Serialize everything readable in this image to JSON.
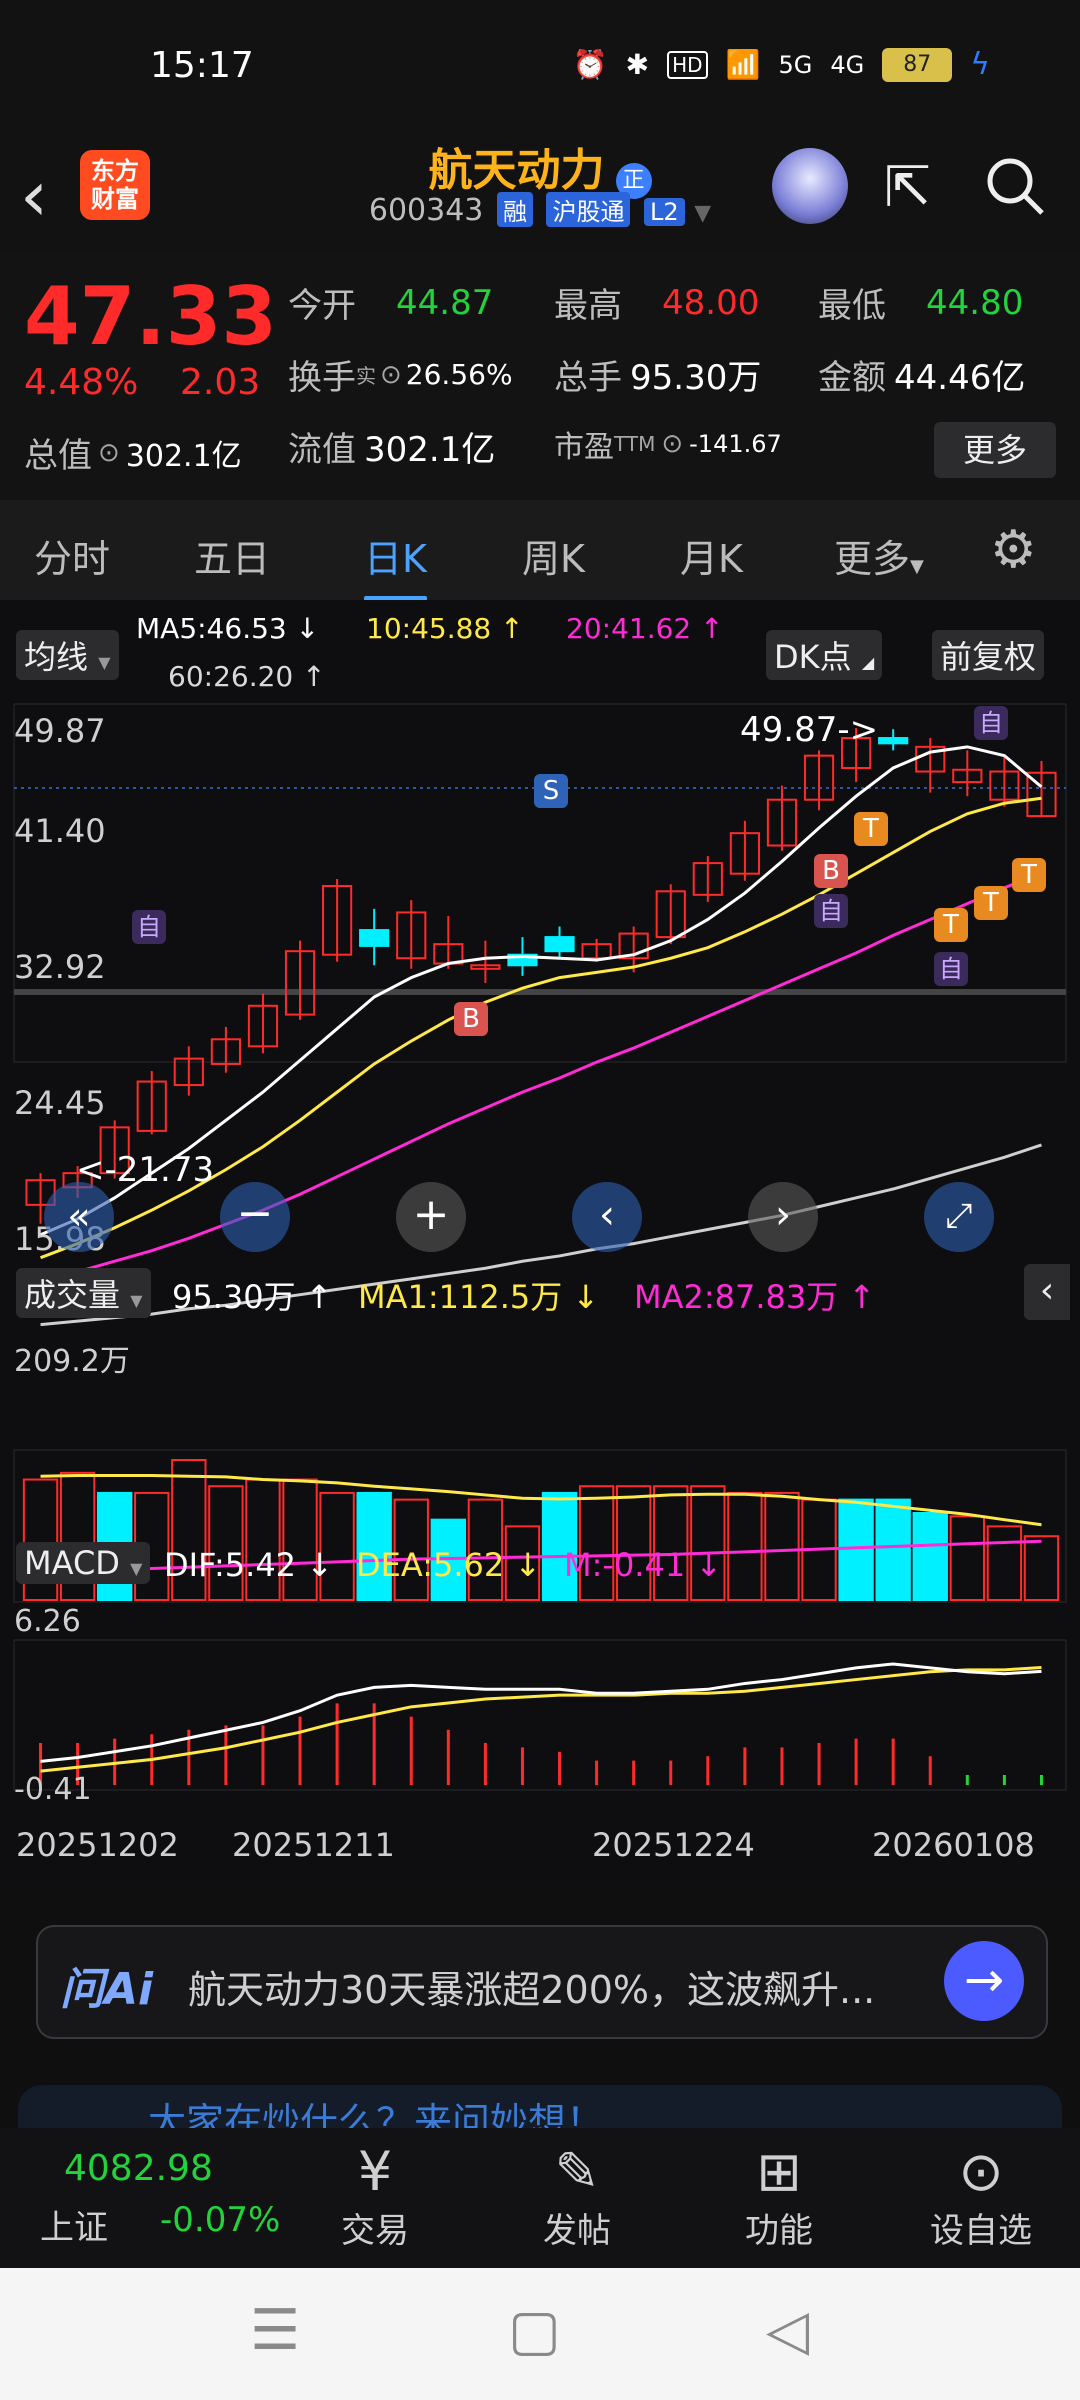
{
  "status": {
    "time": "15:17",
    "network": "5G",
    "network2": "4G",
    "hd": "HD",
    "battery": "87"
  },
  "header": {
    "back": "‹",
    "logo_line1": "东方",
    "logo_line2": "财富",
    "stock_name": "航天动力",
    "name_badge": "正",
    "code": "600343",
    "tags": [
      "融",
      "沪股通",
      "L2"
    ]
  },
  "quote": {
    "price": "47.33",
    "change_pct": "4.48%",
    "change_amt": "2.03",
    "open_label": "今开",
    "open": "44.87",
    "high_label": "最高",
    "high": "48.00",
    "low_label": "最低",
    "low": "44.80",
    "turnover_label": "换手",
    "turnover_sup": "实",
    "turnover": "26.56%",
    "volume_label": "总手",
    "volume": "95.30万",
    "amount_label": "金额",
    "amount": "44.46亿",
    "total_mv_label": "总值",
    "total_mv": "302.1亿",
    "float_mv_label": "流值",
    "float_mv": "302.1亿",
    "pe_label": "市盈",
    "pe_sup": "TTM",
    "pe": "-141.67",
    "more": "更多"
  },
  "tabs": [
    "分时",
    "五日",
    "日K",
    "周K",
    "月K",
    "更多"
  ],
  "active_tab": "日K",
  "kline": {
    "ma_chip": "均线",
    "ma5": "MA5:46.53 ↓",
    "ma10": "10:45.88 ↑",
    "ma20": "20:41.62 ↑",
    "ma60": "60:26.20 ↑",
    "dk_chip": "DK点",
    "adjust_chip": "前复权",
    "y_labels": [
      "49.87",
      "41.40",
      "32.92",
      "24.45",
      "15.98"
    ],
    "high_mark": "49.87->",
    "low_mark": "<-21.73",
    "mark_s": "S",
    "mark_b": "B",
    "mark_t": "T",
    "mark_self": "自"
  },
  "volume": {
    "chip": "成交量",
    "value": "95.30万 ↑",
    "ma1": "MA1:112.5万 ↓",
    "ma2": "MA2:87.83万 ↑",
    "y_label": "209.2万"
  },
  "macd": {
    "chip": "MACD",
    "dif": "DIF:5.42 ↓",
    "dea": "DEA:5.62 ↓",
    "m": "M:-0.41 ↓",
    "y_top": "6.26",
    "y_bottom": "-0.41",
    "dates": [
      "20251202",
      "20251211",
      "20251224",
      "20260108"
    ]
  },
  "ai": {
    "logo": "问Ai",
    "text": "航天动力30天暴涨超200%，这波飙升..."
  },
  "peek_text": "大家在炒什么？来问妙想！",
  "bottom_nav": {
    "index_value": "4082.98",
    "index_name": "上证",
    "index_change": "-0.07%",
    "items": [
      "交易",
      "发帖",
      "功能",
      "设自选"
    ]
  },
  "colors": {
    "up": "#ff2b2b",
    "down": "#22d33b",
    "ma5": "#ffffff",
    "ma10": "#ffe84a",
    "ma20": "#ff2bd6",
    "ma60": "#cfcfcf",
    "cyan": "#00f0ff"
  },
  "chart_data": {
    "type": "candlestick",
    "candles": [
      {
        "o": 22.8,
        "h": 24.6,
        "l": 21.73,
        "c": 24.2
      },
      {
        "o": 23.8,
        "h": 25.0,
        "l": 23.2,
        "c": 24.6
      },
      {
        "o": 24.6,
        "h": 27.6,
        "l": 24.3,
        "c": 27.2
      },
      {
        "o": 27.0,
        "h": 30.4,
        "l": 26.8,
        "c": 29.8
      },
      {
        "o": 29.6,
        "h": 31.8,
        "l": 29.0,
        "c": 31.1
      },
      {
        "o": 30.8,
        "h": 32.9,
        "l": 30.3,
        "c": 32.2
      },
      {
        "o": 31.8,
        "h": 34.8,
        "l": 31.4,
        "c": 34.1
      },
      {
        "o": 33.6,
        "h": 37.8,
        "l": 33.3,
        "c": 37.2
      },
      {
        "o": 37.0,
        "h": 41.3,
        "l": 36.6,
        "c": 40.9
      },
      {
        "o": 38.4,
        "h": 39.6,
        "l": 36.4,
        "c": 37.5
      },
      {
        "o": 36.8,
        "h": 40.1,
        "l": 36.2,
        "c": 39.4
      },
      {
        "o": 37.6,
        "h": 39.2,
        "l": 36.2,
        "c": 36.5
      },
      {
        "o": 36.2,
        "h": 37.8,
        "l": 35.4,
        "c": 36.4
      },
      {
        "o": 36.4,
        "h": 38.0,
        "l": 35.8,
        "c": 37.0
      },
      {
        "o": 37.2,
        "h": 38.6,
        "l": 36.8,
        "c": 38.0
      },
      {
        "o": 37.6,
        "h": 37.9,
        "l": 36.6,
        "c": 36.8
      },
      {
        "o": 36.8,
        "h": 38.6,
        "l": 36.0,
        "c": 38.2
      },
      {
        "o": 38.0,
        "h": 41.0,
        "l": 37.6,
        "c": 40.6
      },
      {
        "o": 40.4,
        "h": 42.6,
        "l": 40.0,
        "c": 42.2
      },
      {
        "o": 41.6,
        "h": 44.6,
        "l": 41.2,
        "c": 43.9
      },
      {
        "o": 43.2,
        "h": 46.6,
        "l": 42.9,
        "c": 45.8
      },
      {
        "o": 45.8,
        "h": 48.6,
        "l": 45.2,
        "c": 48.3
      },
      {
        "o": 47.6,
        "h": 49.87,
        "l": 46.8,
        "c": 49.3
      },
      {
        "o": 49.0,
        "h": 49.8,
        "l": 48.6,
        "c": 49.3
      },
      {
        "o": 48.8,
        "h": 49.3,
        "l": 46.2,
        "c": 47.4
      },
      {
        "o": 46.8,
        "h": 48.6,
        "l": 46.0,
        "c": 47.5
      },
      {
        "o": 45.8,
        "h": 48.2,
        "l": 45.4,
        "c": 47.4
      },
      {
        "o": 44.87,
        "h": 48.0,
        "l": 44.8,
        "c": 47.33
      }
    ],
    "ma5": [
      21.1,
      22.0,
      23.2,
      24.6,
      26.0,
      27.6,
      29.2,
      31.0,
      32.8,
      34.6,
      35.7,
      36.5,
      36.8,
      36.9,
      36.8,
      36.7,
      37.0,
      37.8,
      39.0,
      40.5,
      42.3,
      44.2,
      46.0,
      47.6,
      48.5,
      48.8,
      48.3,
      46.53
    ],
    "ma10": [
      19.8,
      20.6,
      21.5,
      22.5,
      23.6,
      24.8,
      26.1,
      27.6,
      29.2,
      30.8,
      32.1,
      33.3,
      34.3,
      35.1,
      35.7,
      36.0,
      36.3,
      36.8,
      37.4,
      38.3,
      39.3,
      40.4,
      41.6,
      42.8,
      44.0,
      45.0,
      45.6,
      45.88
    ],
    "ma20": [
      18.5,
      19.0,
      19.6,
      20.2,
      20.9,
      21.7,
      22.5,
      23.4,
      24.4,
      25.4,
      26.4,
      27.4,
      28.3,
      29.2,
      30.0,
      30.9,
      31.7,
      32.6,
      33.5,
      34.4,
      35.3,
      36.2,
      37.1,
      38.1,
      39.0,
      39.9,
      40.8,
      41.62
    ],
    "ma60": [
      16.0,
      16.2,
      16.4,
      16.6,
      16.9,
      17.1,
      17.4,
      17.7,
      18.0,
      18.3,
      18.6,
      18.9,
      19.2,
      19.6,
      19.9,
      20.3,
      20.6,
      21.0,
      21.4,
      21.8,
      22.2,
      22.7,
      23.2,
      23.7,
      24.3,
      24.9,
      25.5,
      26.2
    ],
    "ylim": [
      15.98,
      49.87
    ],
    "volume": [
      180,
      190,
      160,
      160,
      209.2,
      170,
      180,
      180,
      160,
      160,
      150,
      120,
      150,
      110,
      160,
      170,
      170,
      170,
      170,
      160,
      160,
      150,
      150,
      150,
      130,
      125,
      110,
      95.3
    ],
    "volume_ma1": [
      185,
      186,
      186,
      186,
      185,
      184,
      180,
      178,
      175,
      170,
      166,
      162,
      157,
      152,
      151,
      152,
      154,
      157,
      158,
      158,
      155,
      150,
      146,
      140,
      134,
      128,
      120,
      112.5
    ],
    "volume_ma2": [
      40,
      43,
      45,
      47,
      49,
      51,
      53,
      55,
      57,
      59,
      61,
      62,
      63,
      64,
      65,
      66,
      67,
      68,
      70,
      72,
      74,
      76,
      78,
      80,
      82,
      84,
      86,
      87.83
    ],
    "dif": [
      0.8,
      1.0,
      1.3,
      1.6,
      2.0,
      2.4,
      2.8,
      3.4,
      4.2,
      4.6,
      4.7,
      4.6,
      4.5,
      4.5,
      4.5,
      4.3,
      4.3,
      4.4,
      4.5,
      4.8,
      5.0,
      5.3,
      5.6,
      5.8,
      5.6,
      5.4,
      5.3,
      5.42
    ],
    "dea": [
      0.3,
      0.5,
      0.7,
      0.9,
      1.2,
      1.5,
      1.9,
      2.3,
      2.8,
      3.2,
      3.6,
      3.8,
      4.0,
      4.1,
      4.2,
      4.2,
      4.2,
      4.3,
      4.3,
      4.4,
      4.6,
      4.8,
      5.0,
      5.2,
      5.4,
      5.5,
      5.5,
      5.62
    ],
    "macd_ylim": [
      -0.41,
      6.26
    ],
    "dates": [
      "20251202",
      "20251211",
      "20251224",
      "20260108"
    ]
  }
}
